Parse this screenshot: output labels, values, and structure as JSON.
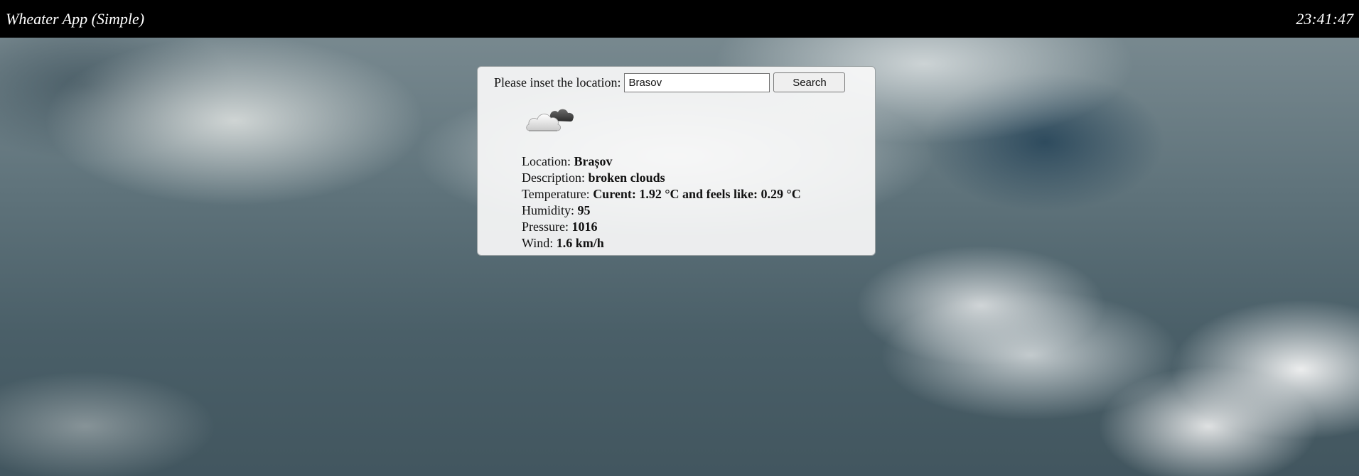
{
  "app": {
    "title": "Wheater App (Simple)",
    "clock": "23:41:47"
  },
  "search": {
    "label": "Please inset the location:",
    "value": "Brasov",
    "button_label": "Search"
  },
  "weather": {
    "icon": "broken-clouds-icon",
    "rows": [
      {
        "label": "Location:",
        "value": "Brașov"
      },
      {
        "label": "Description:",
        "value": "broken clouds"
      },
      {
        "label": "Temperature:",
        "value": "Curent: 1.92 °C and feels like: 0.29 °C"
      },
      {
        "label": "Humidity:",
        "value": "95"
      },
      {
        "label": "Pressure:",
        "value": "1016"
      },
      {
        "label": "Wind:",
        "value": "1.6 km/h"
      }
    ]
  }
}
